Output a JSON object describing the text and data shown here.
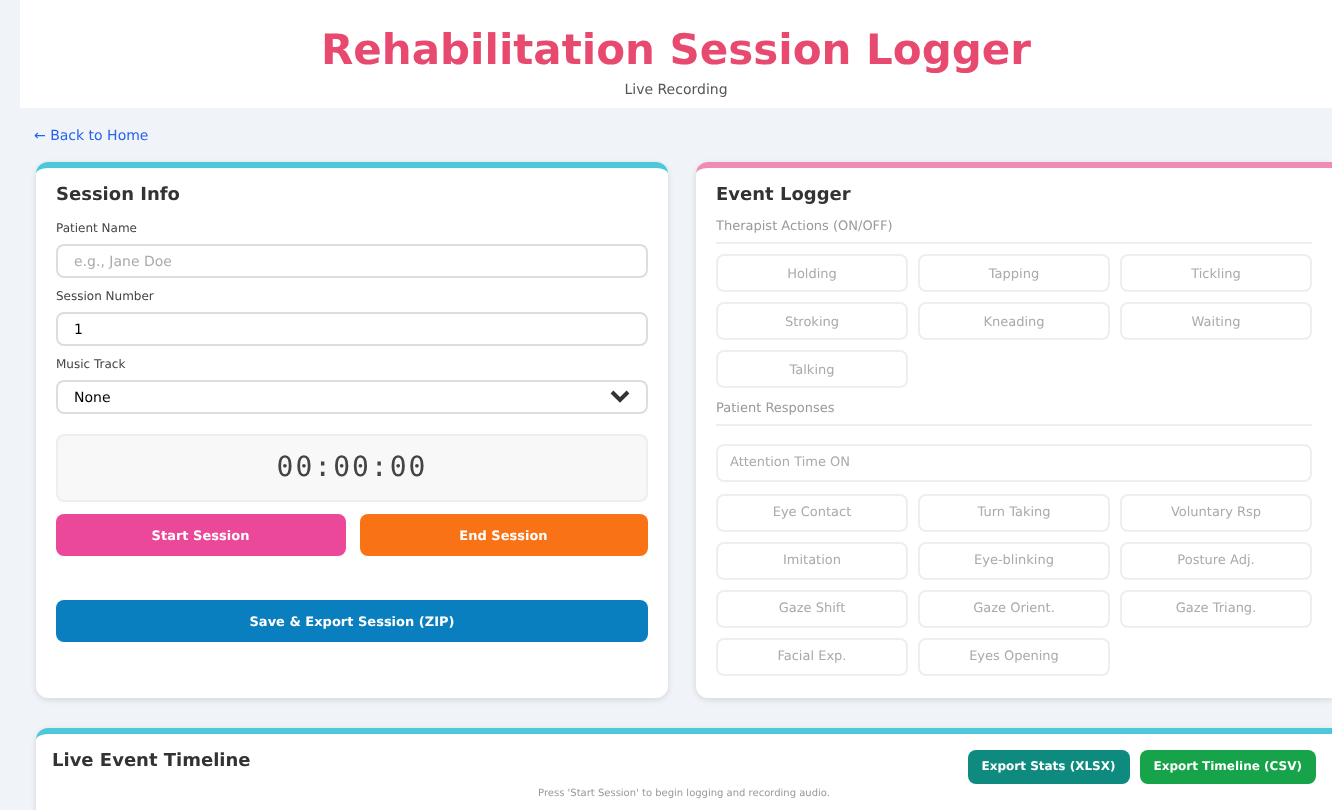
{
  "header": {
    "title": "Rehabilitation Session Logger",
    "subtitle": "Live Recording"
  },
  "back_link": "← Back to Home",
  "session_info": {
    "title": "Session Info",
    "fields": [
      {
        "kind": "text",
        "label": "Patient Name",
        "placeholder": "e.g., Jane Doe"
      },
      {
        "kind": "text",
        "label": "Session Number",
        "value": "1"
      },
      {
        "kind": "select",
        "label": "Music Track",
        "value": "None"
      }
    ],
    "timer": "00:00:00",
    "buttons": [
      {
        "label": "Start Session",
        "color": "#ec4899"
      },
      {
        "label": "End Session",
        "color": "#f97316"
      }
    ],
    "export_button": "Save & Export Session (ZIP)"
  },
  "event_logger": {
    "title": "Event Logger",
    "disabled": true,
    "therapist_heading": "Therapist Actions (ON/OFF)",
    "therapist_actions": [
      "Holding",
      "Tapping",
      "Tickling",
      "Stroking",
      "Kneading",
      "Waiting",
      "Talking"
    ],
    "patient_heading": "Patient Responses",
    "attention_button": "Attention Time ON",
    "patient_responses": [
      "Eye Contact",
      "Turn Taking",
      "Voluntary Rsp",
      "Imitation",
      "Eye-blinking",
      "Posture Adj.",
      "Gaze Shift",
      "Gaze Orient.",
      "Gaze Triang.",
      "Facial Exp.",
      "Eyes Opening"
    ]
  },
  "timeline": {
    "title": "Live Event Timeline",
    "buttons": [
      {
        "label": "Export Stats (XLSX)",
        "color": "#0f8a7e"
      },
      {
        "label": "Export Timeline (CSV)",
        "color": "#16a34a"
      }
    ],
    "message": "Press 'Start Session' to begin logging and recording audio."
  }
}
